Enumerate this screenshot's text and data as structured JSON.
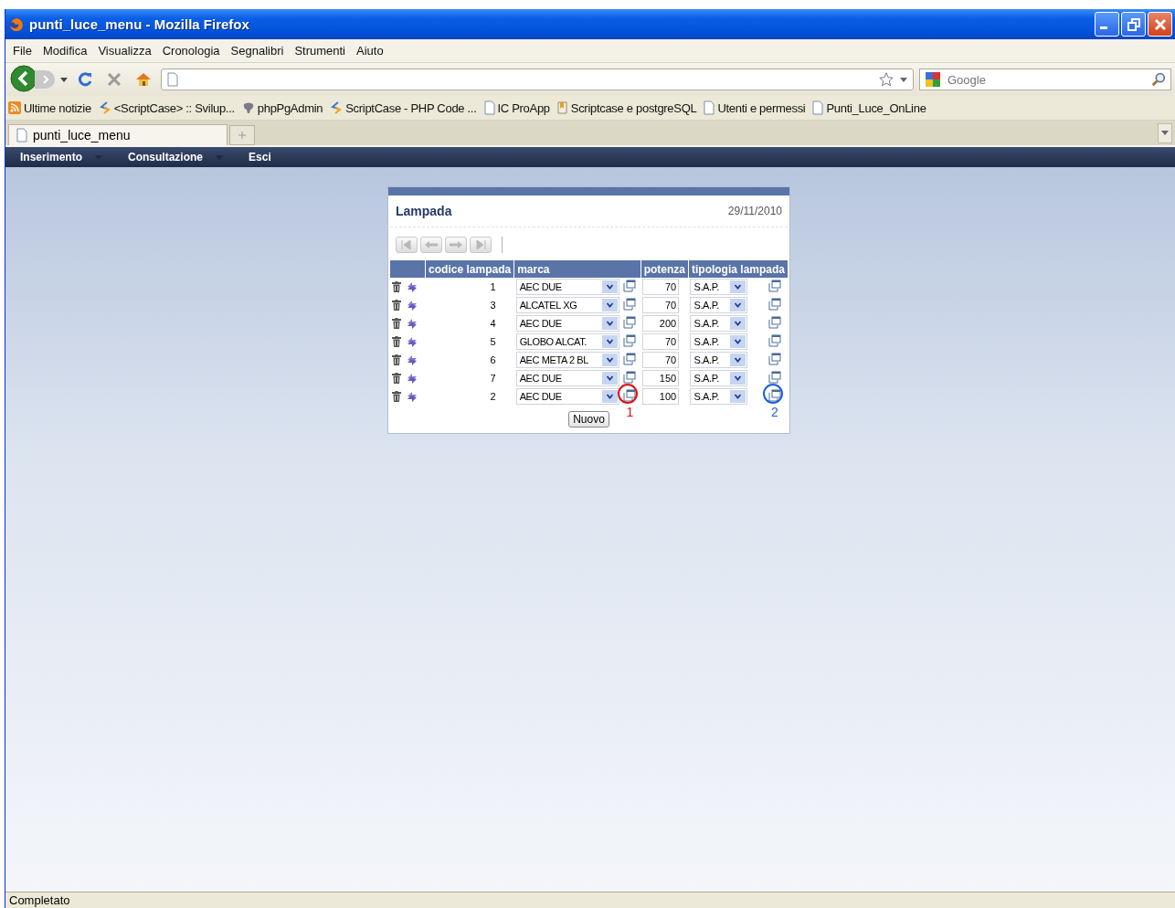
{
  "window": {
    "title": "punti_luce_menu - Mozilla Firefox"
  },
  "menu": [
    "File",
    "Modifica",
    "Visualizza",
    "Cronologia",
    "Segnalibri",
    "Strumenti",
    "Aiuto"
  ],
  "search": {
    "placeholder": "Google"
  },
  "bookmarks": [
    {
      "label": "Ultime notizie",
      "kind": "feed"
    },
    {
      "label": "<ScriptCase> :: Svilup...",
      "kind": "scriptcase"
    },
    {
      "label": "phpPgAdmin",
      "kind": "elephant"
    },
    {
      "label": "ScriptCase - PHP Code ...",
      "kind": "scriptcase"
    },
    {
      "label": "IC ProApp",
      "kind": "page"
    },
    {
      "label": "Scriptcase e postgreSQL",
      "kind": "bookmark"
    },
    {
      "label": "Utenti e permessi",
      "kind": "page"
    },
    {
      "label": "Punti_Luce_OnLine",
      "kind": "page"
    }
  ],
  "tabs": [
    {
      "label": "punti_luce_menu",
      "selected": true
    }
  ],
  "app_menu": [
    {
      "label": "Inserimento",
      "dropdown": true
    },
    {
      "label": "Consultazione",
      "dropdown": true
    },
    {
      "label": "Esci",
      "dropdown": false
    }
  ],
  "form": {
    "title": "Lampada",
    "date": "29/11/2010",
    "nav_buttons": [
      {
        "kind": "first",
        "disabled": true
      },
      {
        "kind": "prev",
        "disabled": true
      },
      {
        "kind": "next",
        "disabled": true
      },
      {
        "kind": "last",
        "disabled": true
      }
    ],
    "columns": [
      "codice lampada",
      "marca",
      "potenza",
      "tipologia lampada"
    ],
    "rows": [
      {
        "codice": "1",
        "marca": "AEC DUE",
        "potenza": "70",
        "tipologia": "S.A.P."
      },
      {
        "codice": "3",
        "marca": "ALCATEL XG",
        "potenza": "70",
        "tipologia": "S.A.P."
      },
      {
        "codice": "4",
        "marca": "AEC DUE",
        "potenza": "200",
        "tipologia": "S.A.P."
      },
      {
        "codice": "5",
        "marca": "GLOBO ALCAT.",
        "potenza": "70",
        "tipologia": "S.A.P."
      },
      {
        "codice": "6",
        "marca": "AEC META 2 BL",
        "potenza": "70",
        "tipologia": "S.A.P."
      },
      {
        "codice": "7",
        "marca": "AEC DUE",
        "potenza": "150",
        "tipologia": "S.A.P."
      },
      {
        "codice": "2",
        "marca": "AEC DUE",
        "potenza": "100",
        "tipologia": "S.A.P.",
        "annotations": [
          {
            "kind": "marca",
            "label": "1",
            "color": "#e01010"
          },
          {
            "kind": "tipologia",
            "label": "2",
            "color": "#1a5fe0"
          }
        ]
      }
    ],
    "new_button": "Nuovo"
  },
  "status_bar": "Completato"
}
